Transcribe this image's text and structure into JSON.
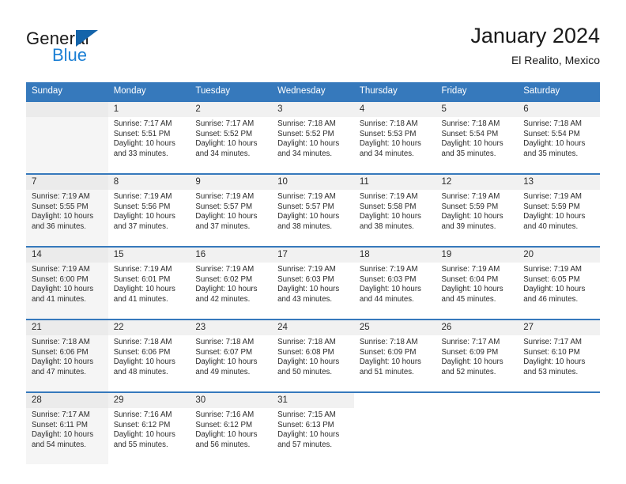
{
  "brand": {
    "name_top": "General",
    "name_bottom": "Blue",
    "accent_color": "#1b7fd4",
    "triangle_color": "#1464aa"
  },
  "header": {
    "title": "January 2024",
    "subtitle": "El Realito, Mexico"
  },
  "calendar": {
    "header_bg": "#3679bc",
    "weekday_headers": [
      "Sunday",
      "Monday",
      "Tuesday",
      "Wednesday",
      "Thursday",
      "Friday",
      "Saturday"
    ],
    "weeks": [
      [
        {
          "day": "",
          "sunrise": "",
          "sunset": "",
          "daylight_line1": "",
          "daylight_line2": ""
        },
        {
          "day": "1",
          "sunrise": "Sunrise: 7:17 AM",
          "sunset": "Sunset: 5:51 PM",
          "daylight_line1": "Daylight: 10 hours",
          "daylight_line2": "and 33 minutes."
        },
        {
          "day": "2",
          "sunrise": "Sunrise: 7:17 AM",
          "sunset": "Sunset: 5:52 PM",
          "daylight_line1": "Daylight: 10 hours",
          "daylight_line2": "and 34 minutes."
        },
        {
          "day": "3",
          "sunrise": "Sunrise: 7:18 AM",
          "sunset": "Sunset: 5:52 PM",
          "daylight_line1": "Daylight: 10 hours",
          "daylight_line2": "and 34 minutes."
        },
        {
          "day": "4",
          "sunrise": "Sunrise: 7:18 AM",
          "sunset": "Sunset: 5:53 PM",
          "daylight_line1": "Daylight: 10 hours",
          "daylight_line2": "and 34 minutes."
        },
        {
          "day": "5",
          "sunrise": "Sunrise: 7:18 AM",
          "sunset": "Sunset: 5:54 PM",
          "daylight_line1": "Daylight: 10 hours",
          "daylight_line2": "and 35 minutes."
        },
        {
          "day": "6",
          "sunrise": "Sunrise: 7:18 AM",
          "sunset": "Sunset: 5:54 PM",
          "daylight_line1": "Daylight: 10 hours",
          "daylight_line2": "and 35 minutes."
        }
      ],
      [
        {
          "day": "7",
          "sunrise": "Sunrise: 7:19 AM",
          "sunset": "Sunset: 5:55 PM",
          "daylight_line1": "Daylight: 10 hours",
          "daylight_line2": "and 36 minutes."
        },
        {
          "day": "8",
          "sunrise": "Sunrise: 7:19 AM",
          "sunset": "Sunset: 5:56 PM",
          "daylight_line1": "Daylight: 10 hours",
          "daylight_line2": "and 37 minutes."
        },
        {
          "day": "9",
          "sunrise": "Sunrise: 7:19 AM",
          "sunset": "Sunset: 5:57 PM",
          "daylight_line1": "Daylight: 10 hours",
          "daylight_line2": "and 37 minutes."
        },
        {
          "day": "10",
          "sunrise": "Sunrise: 7:19 AM",
          "sunset": "Sunset: 5:57 PM",
          "daylight_line1": "Daylight: 10 hours",
          "daylight_line2": "and 38 minutes."
        },
        {
          "day": "11",
          "sunrise": "Sunrise: 7:19 AM",
          "sunset": "Sunset: 5:58 PM",
          "daylight_line1": "Daylight: 10 hours",
          "daylight_line2": "and 38 minutes."
        },
        {
          "day": "12",
          "sunrise": "Sunrise: 7:19 AM",
          "sunset": "Sunset: 5:59 PM",
          "daylight_line1": "Daylight: 10 hours",
          "daylight_line2": "and 39 minutes."
        },
        {
          "day": "13",
          "sunrise": "Sunrise: 7:19 AM",
          "sunset": "Sunset: 5:59 PM",
          "daylight_line1": "Daylight: 10 hours",
          "daylight_line2": "and 40 minutes."
        }
      ],
      [
        {
          "day": "14",
          "sunrise": "Sunrise: 7:19 AM",
          "sunset": "Sunset: 6:00 PM",
          "daylight_line1": "Daylight: 10 hours",
          "daylight_line2": "and 41 minutes."
        },
        {
          "day": "15",
          "sunrise": "Sunrise: 7:19 AM",
          "sunset": "Sunset: 6:01 PM",
          "daylight_line1": "Daylight: 10 hours",
          "daylight_line2": "and 41 minutes."
        },
        {
          "day": "16",
          "sunrise": "Sunrise: 7:19 AM",
          "sunset": "Sunset: 6:02 PM",
          "daylight_line1": "Daylight: 10 hours",
          "daylight_line2": "and 42 minutes."
        },
        {
          "day": "17",
          "sunrise": "Sunrise: 7:19 AM",
          "sunset": "Sunset: 6:03 PM",
          "daylight_line1": "Daylight: 10 hours",
          "daylight_line2": "and 43 minutes."
        },
        {
          "day": "18",
          "sunrise": "Sunrise: 7:19 AM",
          "sunset": "Sunset: 6:03 PM",
          "daylight_line1": "Daylight: 10 hours",
          "daylight_line2": "and 44 minutes."
        },
        {
          "day": "19",
          "sunrise": "Sunrise: 7:19 AM",
          "sunset": "Sunset: 6:04 PM",
          "daylight_line1": "Daylight: 10 hours",
          "daylight_line2": "and 45 minutes."
        },
        {
          "day": "20",
          "sunrise": "Sunrise: 7:19 AM",
          "sunset": "Sunset: 6:05 PM",
          "daylight_line1": "Daylight: 10 hours",
          "daylight_line2": "and 46 minutes."
        }
      ],
      [
        {
          "day": "21",
          "sunrise": "Sunrise: 7:18 AM",
          "sunset": "Sunset: 6:06 PM",
          "daylight_line1": "Daylight: 10 hours",
          "daylight_line2": "and 47 minutes."
        },
        {
          "day": "22",
          "sunrise": "Sunrise: 7:18 AM",
          "sunset": "Sunset: 6:06 PM",
          "daylight_line1": "Daylight: 10 hours",
          "daylight_line2": "and 48 minutes."
        },
        {
          "day": "23",
          "sunrise": "Sunrise: 7:18 AM",
          "sunset": "Sunset: 6:07 PM",
          "daylight_line1": "Daylight: 10 hours",
          "daylight_line2": "and 49 minutes."
        },
        {
          "day": "24",
          "sunrise": "Sunrise: 7:18 AM",
          "sunset": "Sunset: 6:08 PM",
          "daylight_line1": "Daylight: 10 hours",
          "daylight_line2": "and 50 minutes."
        },
        {
          "day": "25",
          "sunrise": "Sunrise: 7:18 AM",
          "sunset": "Sunset: 6:09 PM",
          "daylight_line1": "Daylight: 10 hours",
          "daylight_line2": "and 51 minutes."
        },
        {
          "day": "26",
          "sunrise": "Sunrise: 7:17 AM",
          "sunset": "Sunset: 6:09 PM",
          "daylight_line1": "Daylight: 10 hours",
          "daylight_line2": "and 52 minutes."
        },
        {
          "day": "27",
          "sunrise": "Sunrise: 7:17 AM",
          "sunset": "Sunset: 6:10 PM",
          "daylight_line1": "Daylight: 10 hours",
          "daylight_line2": "and 53 minutes."
        }
      ],
      [
        {
          "day": "28",
          "sunrise": "Sunrise: 7:17 AM",
          "sunset": "Sunset: 6:11 PM",
          "daylight_line1": "Daylight: 10 hours",
          "daylight_line2": "and 54 minutes."
        },
        {
          "day": "29",
          "sunrise": "Sunrise: 7:16 AM",
          "sunset": "Sunset: 6:12 PM",
          "daylight_line1": "Daylight: 10 hours",
          "daylight_line2": "and 55 minutes."
        },
        {
          "day": "30",
          "sunrise": "Sunrise: 7:16 AM",
          "sunset": "Sunset: 6:12 PM",
          "daylight_line1": "Daylight: 10 hours",
          "daylight_line2": "and 56 minutes."
        },
        {
          "day": "31",
          "sunrise": "Sunrise: 7:15 AM",
          "sunset": "Sunset: 6:13 PM",
          "daylight_line1": "Daylight: 10 hours",
          "daylight_line2": "and 57 minutes."
        },
        {
          "day": "",
          "sunrise": "",
          "sunset": "",
          "daylight_line1": "",
          "daylight_line2": ""
        },
        {
          "day": "",
          "sunrise": "",
          "sunset": "",
          "daylight_line1": "",
          "daylight_line2": ""
        },
        {
          "day": "",
          "sunrise": "",
          "sunset": "",
          "daylight_line1": "",
          "daylight_line2": ""
        }
      ]
    ]
  }
}
